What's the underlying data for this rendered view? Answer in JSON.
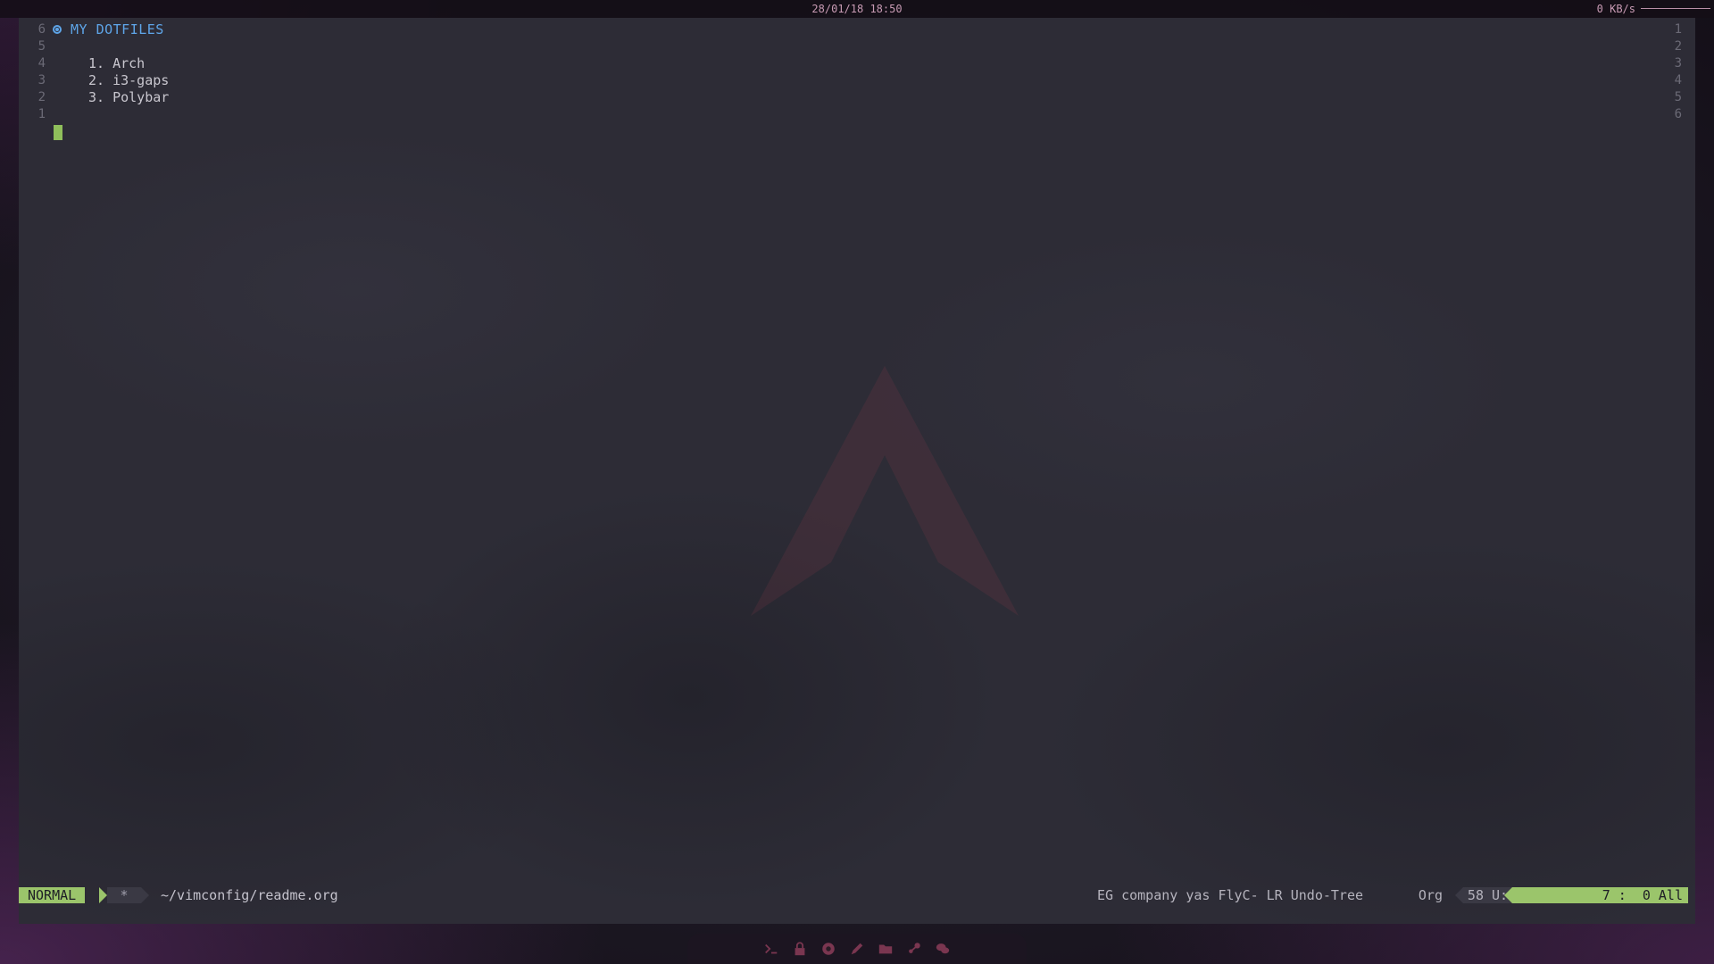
{
  "topbar": {
    "clock": "28/01/18 18:50",
    "net_speed": "0 KB/s"
  },
  "editor": {
    "left_line_numbers": [
      "6",
      "5",
      "4",
      "3",
      "2",
      "1",
      ""
    ],
    "right_line_numbers": [
      "1",
      "2",
      "3",
      "4",
      "5",
      "6",
      ""
    ],
    "heading": "MY DOTFILES",
    "list_items": [
      "1. Arch",
      "2. i3-gaps",
      "3. Polybar"
    ]
  },
  "modeline": {
    "mode": "NORMAL",
    "modified_flag": "*",
    "file_path": "~/vimconfig/readme.org",
    "minor_modes": "EG company yas FlyC- LR Undo-Tree",
    "major_mode": "Org",
    "undo_segment": "58 U:",
    "position": "7 :  0 All"
  },
  "dock": {
    "icons": [
      "terminal-icon",
      "lock-icon",
      "browser-icon",
      "pencil-icon",
      "folder-icon",
      "steam-icon",
      "chat-icon"
    ]
  },
  "colors": {
    "accent_blue": "#5ea5e8",
    "mode_green": "#9bc56b",
    "bar_pink": "#c79ab3",
    "dock_icon": "#7a3650"
  }
}
